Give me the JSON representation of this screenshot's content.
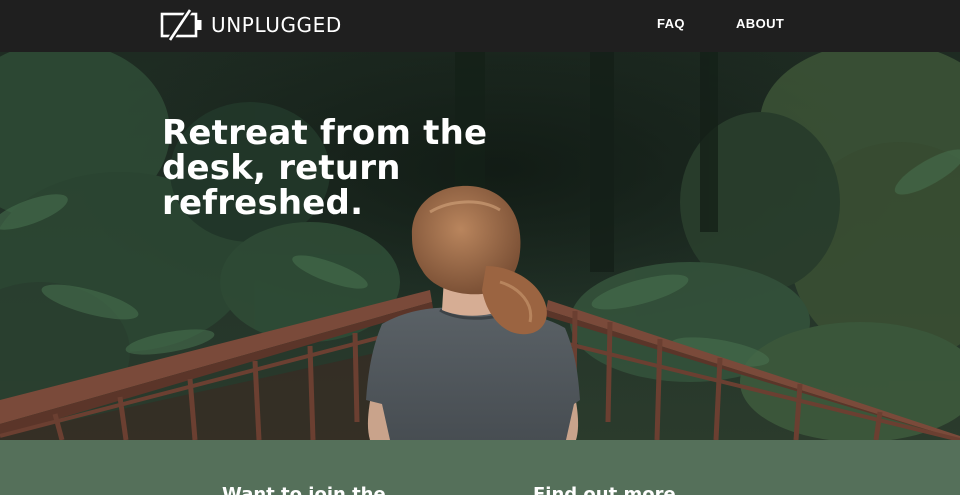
{
  "header": {
    "brand": "UNPLUGGED",
    "logo_icon": "battery-slash-icon",
    "nav": [
      {
        "label": "FAQ"
      },
      {
        "label": "ABOUT"
      }
    ]
  },
  "hero": {
    "heading_lines": [
      "Retreat from the",
      "desk, return",
      "refreshed."
    ]
  },
  "band": {
    "join_text": "Want to join the",
    "find_text": "Find out more"
  },
  "colors": {
    "header_bg": "#1f1f1f",
    "band_bg": "#55705a",
    "text": "#ffffff",
    "bridge_rust": "#7a4a3a",
    "shirt": "#4f565b"
  }
}
